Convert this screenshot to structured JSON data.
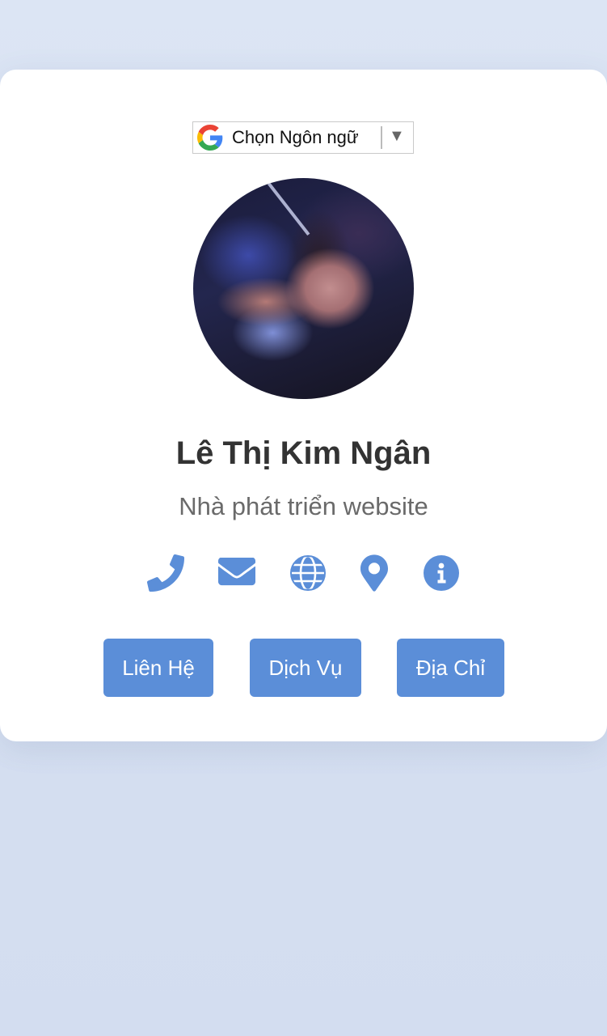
{
  "language_selector": {
    "label": "Chọn Ngôn ngữ",
    "arrow": "▼",
    "logo_icon": "google-g-icon"
  },
  "profile": {
    "avatar": "profile-photo",
    "name": "Lê Thị Kim Ngân",
    "title": "Nhà phát triển website"
  },
  "contact_icons": [
    {
      "icon": "phone-icon"
    },
    {
      "icon": "envelope-icon"
    },
    {
      "icon": "globe-icon"
    },
    {
      "icon": "map-marker-icon"
    },
    {
      "icon": "info-icon"
    }
  ],
  "buttons": {
    "contact": "Liên Hệ",
    "services": "Dịch Vụ",
    "address": "Địa Chỉ"
  },
  "colors": {
    "accent": "#5b8ed8",
    "name_text": "#333333",
    "subtitle_text": "#6a6a6a",
    "background": "#dce5f4",
    "card": "#ffffff"
  }
}
